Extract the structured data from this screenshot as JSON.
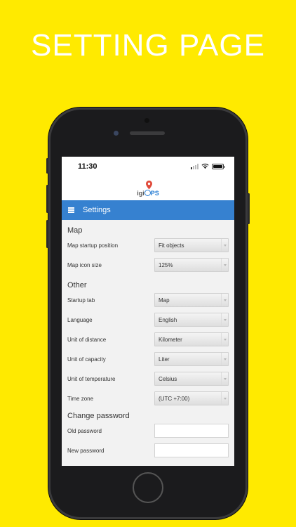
{
  "headline": "SETTING PAGE",
  "status_bar": {
    "time": "11:30"
  },
  "logo": {
    "prefix": "igi",
    "suffix": "PS"
  },
  "header": {
    "title": "Settings"
  },
  "sections": {
    "map": {
      "title": "Map",
      "startup_position": {
        "label": "Map startup position",
        "value": "Fit objects"
      },
      "icon_size": {
        "label": "Map icon size",
        "value": "125%"
      }
    },
    "other": {
      "title": "Other",
      "startup_tab": {
        "label": "Startup tab",
        "value": "Map"
      },
      "language": {
        "label": "Language",
        "value": "English"
      },
      "distance": {
        "label": "Unit of distance",
        "value": "Kilometer"
      },
      "capacity": {
        "label": "Unit of capacity",
        "value": "Liter"
      },
      "temperature": {
        "label": "Unit of temperature",
        "value": "Celsius"
      },
      "timezone": {
        "label": "Time zone",
        "value": "(UTC +7:00)"
      }
    },
    "password": {
      "title": "Change password",
      "old": {
        "label": "Old password",
        "value": ""
      },
      "new": {
        "label": "New password",
        "value": ""
      }
    }
  },
  "colors": {
    "background": "#ffea00",
    "header": "#3681d0",
    "logo_accent": "#2a7fd4",
    "pin": "#e04a3a"
  },
  "icons": [
    "menu-icon",
    "wifi-icon",
    "battery-icon",
    "signal-icon",
    "map-pin-icon",
    "dropdown-arrow-icon"
  ]
}
